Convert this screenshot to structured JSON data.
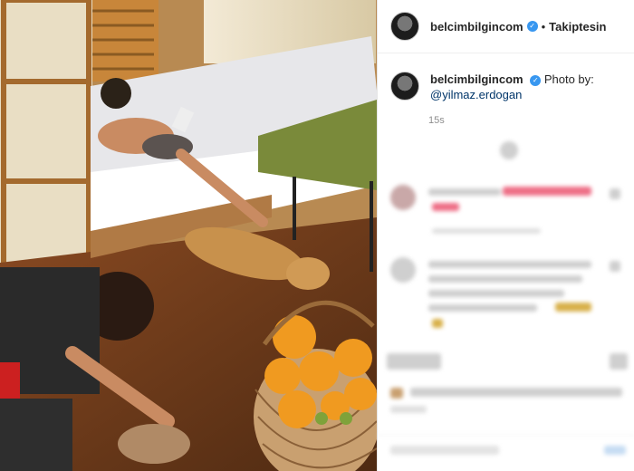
{
  "header": {
    "username": "belcimbilgincom",
    "separator": "•",
    "follow_status": "Takiptesin"
  },
  "caption": {
    "username": "belcimbilgincom",
    "text": "Photo by:",
    "mention": "@yilmaz.erdogan"
  },
  "time_ago": "15s",
  "icons": [
    "verified-badge-icon"
  ],
  "colors": {
    "verified": "#3897f0",
    "mention": "#003569",
    "floor": "#6a3c1c"
  }
}
